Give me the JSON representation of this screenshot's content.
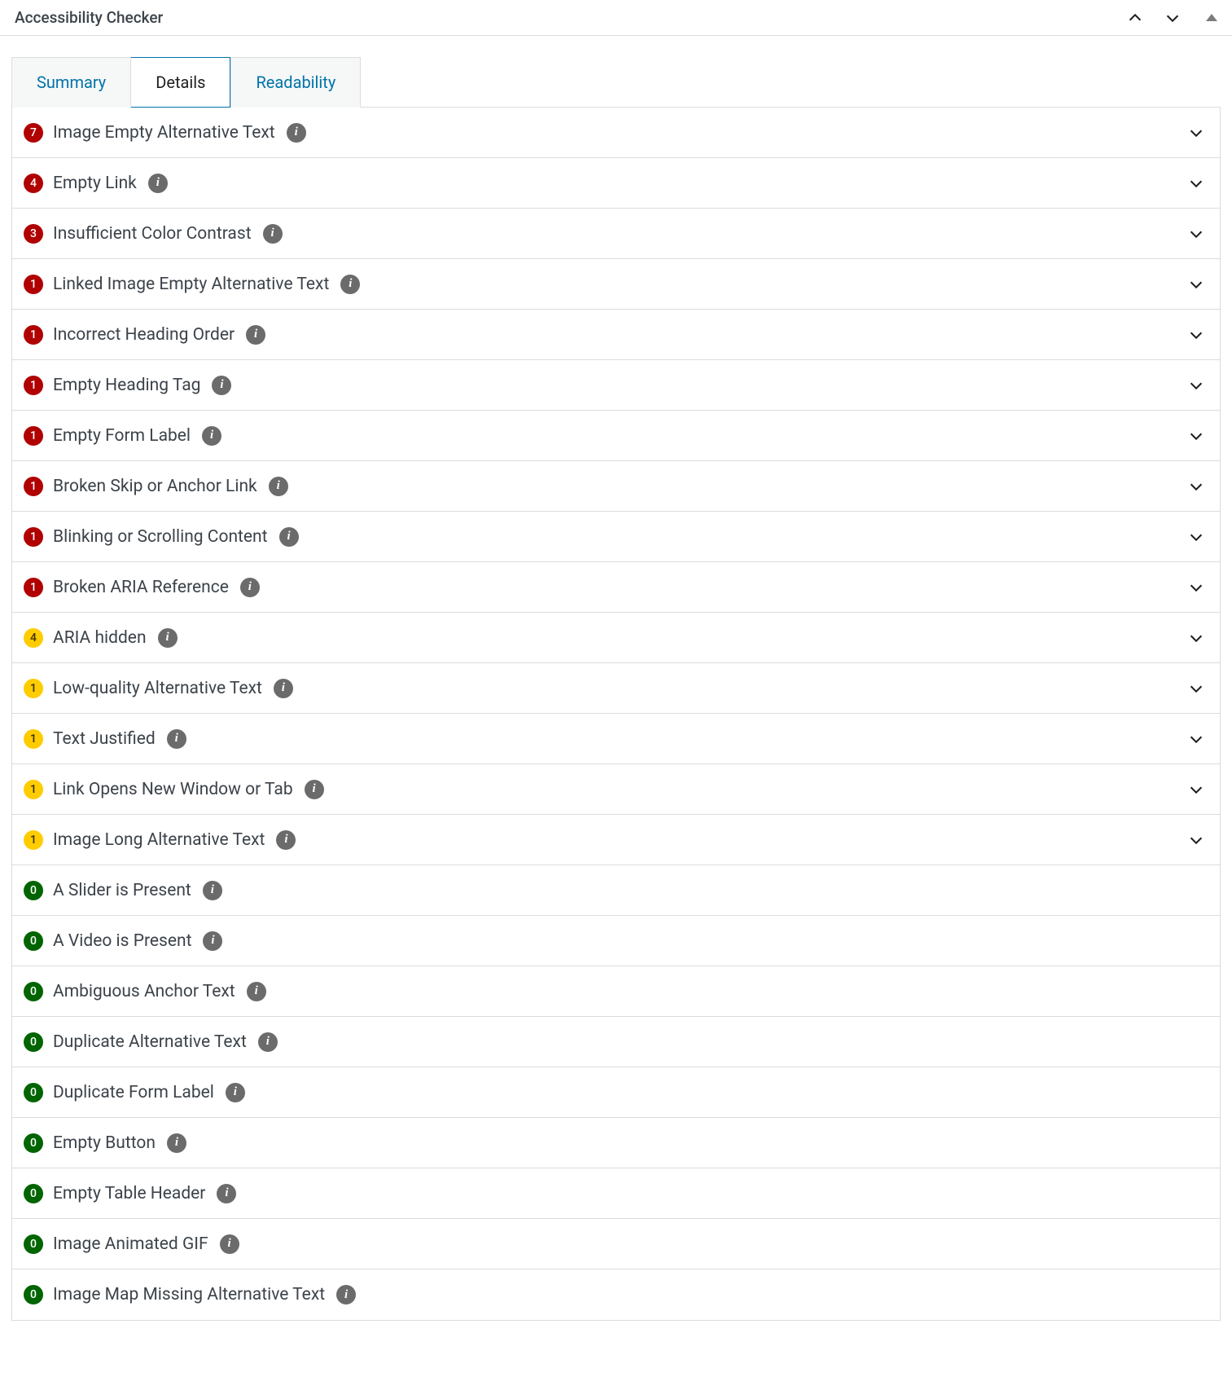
{
  "header": {
    "title": "Accessibility Checker"
  },
  "tabs": [
    {
      "label": "Summary",
      "active": false
    },
    {
      "label": "Details",
      "active": true
    },
    {
      "label": "Readability",
      "active": false
    }
  ],
  "issues": [
    {
      "count": "7",
      "severity": "error",
      "title": "Image Empty Alternative Text",
      "expandable": true
    },
    {
      "count": "4",
      "severity": "error",
      "title": "Empty Link",
      "expandable": true
    },
    {
      "count": "3",
      "severity": "error",
      "title": "Insufficient Color Contrast",
      "expandable": true
    },
    {
      "count": "1",
      "severity": "error",
      "title": "Linked Image Empty Alternative Text",
      "expandable": true
    },
    {
      "count": "1",
      "severity": "error",
      "title": "Incorrect Heading Order",
      "expandable": true
    },
    {
      "count": "1",
      "severity": "error",
      "title": "Empty Heading Tag",
      "expandable": true
    },
    {
      "count": "1",
      "severity": "error",
      "title": "Empty Form Label",
      "expandable": true
    },
    {
      "count": "1",
      "severity": "error",
      "title": "Broken Skip or Anchor Link",
      "expandable": true
    },
    {
      "count": "1",
      "severity": "error",
      "title": "Blinking or Scrolling Content",
      "expandable": true
    },
    {
      "count": "1",
      "severity": "error",
      "title": "Broken ARIA Reference",
      "expandable": true
    },
    {
      "count": "4",
      "severity": "warning",
      "title": "ARIA hidden",
      "expandable": true
    },
    {
      "count": "1",
      "severity": "warning",
      "title": "Low-quality Alternative Text",
      "expandable": true
    },
    {
      "count": "1",
      "severity": "warning",
      "title": "Text Justified",
      "expandable": true
    },
    {
      "count": "1",
      "severity": "warning",
      "title": "Link Opens New Window or Tab",
      "expandable": true
    },
    {
      "count": "1",
      "severity": "warning",
      "title": "Image Long Alternative Text",
      "expandable": true
    },
    {
      "count": "0",
      "severity": "passed",
      "title": "A Slider is Present",
      "expandable": false
    },
    {
      "count": "0",
      "severity": "passed",
      "title": "A Video is Present",
      "expandable": false
    },
    {
      "count": "0",
      "severity": "passed",
      "title": "Ambiguous Anchor Text",
      "expandable": false
    },
    {
      "count": "0",
      "severity": "passed",
      "title": "Duplicate Alternative Text",
      "expandable": false
    },
    {
      "count": "0",
      "severity": "passed",
      "title": "Duplicate Form Label",
      "expandable": false
    },
    {
      "count": "0",
      "severity": "passed",
      "title": "Empty Button",
      "expandable": false
    },
    {
      "count": "0",
      "severity": "passed",
      "title": "Empty Table Header",
      "expandable": false
    },
    {
      "count": "0",
      "severity": "passed",
      "title": "Image Animated GIF",
      "expandable": false
    },
    {
      "count": "0",
      "severity": "passed",
      "title": "Image Map Missing Alternative Text",
      "expandable": false
    }
  ]
}
